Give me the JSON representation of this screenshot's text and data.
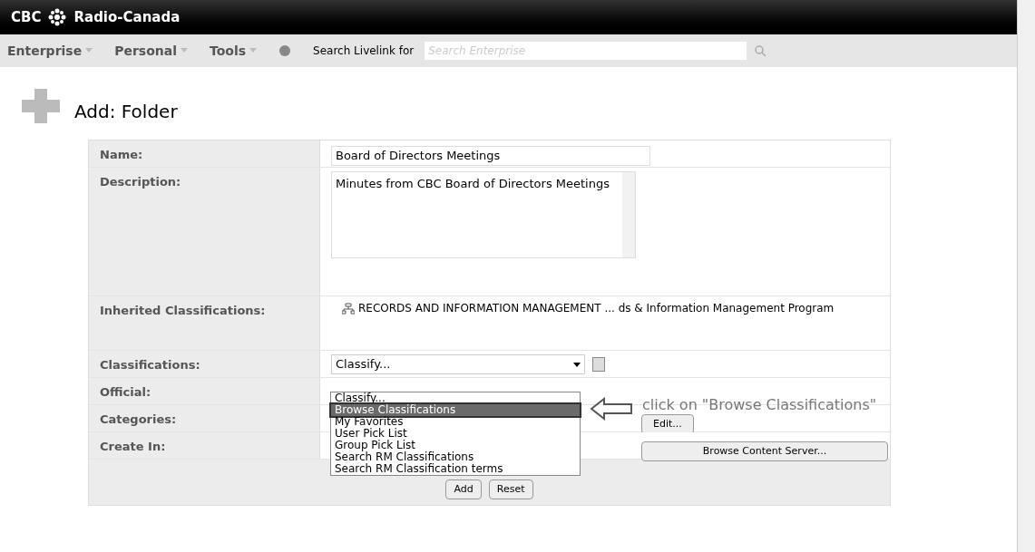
{
  "header": {
    "brand_left": "CBC",
    "brand_right": "Radio-Canada"
  },
  "nav": {
    "menus": [
      "Enterprise",
      "Personal",
      "Tools"
    ],
    "search_label": "Search Livelink for",
    "search_placeholder": "Search Enterprise"
  },
  "page_title": "Add: Folder",
  "form": {
    "rows": [
      {
        "kind": "text",
        "label": "Name:",
        "value": "Board of Directors Meetings"
      },
      {
        "kind": "textarea",
        "label": "Description:",
        "value": "Minutes from CBC Board of Directors Meetings"
      },
      {
        "kind": "inherited",
        "label": "Inherited Classifications:",
        "value": "RECORDS AND INFORMATION MANAGEMENT ... ds & Information Management Program"
      },
      {
        "kind": "select",
        "label": "Classifications:",
        "value": "Classify..."
      },
      {
        "kind": "empty",
        "label": "Official:"
      },
      {
        "kind": "button",
        "label": "Categories:",
        "button": "Edit..."
      },
      {
        "kind": "button",
        "label": "Create In:",
        "button": "Browse Content Server..."
      }
    ],
    "buttons": [
      "Add",
      "Reset"
    ]
  },
  "dropdown": {
    "options": [
      {
        "label": "Classify...",
        "selected": false
      },
      {
        "label": "Browse Classifications",
        "selected": true
      },
      {
        "label": "My Favorites",
        "selected": false
      },
      {
        "label": "User Pick List",
        "selected": false
      },
      {
        "label": "Group Pick List",
        "selected": false
      },
      {
        "label": "Search RM Classifications",
        "selected": false
      },
      {
        "label": "Search RM Classification terms",
        "selected": false
      }
    ]
  },
  "annotation": "click on \"Browse Classifications\""
}
